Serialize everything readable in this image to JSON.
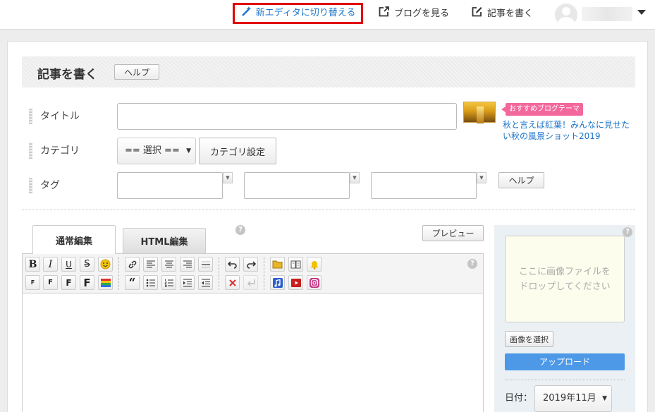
{
  "topbar": {
    "switch_editor": "新エディタに切り替える",
    "view_blog": "ブログを見る",
    "write_post": "記事を書く"
  },
  "header": {
    "title": "記事を書く",
    "help": "ヘルプ"
  },
  "form": {
    "title_label": "タイトル",
    "category_label": "カテゴリ",
    "category_value": "== 選択 ==",
    "category_settings": "カテゴリ設定",
    "tag_label": "タグ",
    "tag_help": "ヘルプ"
  },
  "theme": {
    "badge": "おすすめブログテーマ",
    "link": "秋と言えば紅葉！みんなに見せたい秋の風景ショット2019"
  },
  "editor": {
    "tab_normal": "通常編集",
    "tab_html": "HTML編集",
    "preview": "プレビュー",
    "help_mark": "?"
  },
  "sidebar": {
    "dropzone": "ここに画像ファイルをドロップしてください",
    "select_image": "画像を選択",
    "upload": "アップロード",
    "date_label": "日付：",
    "date_value": "2019年11月"
  },
  "colors": {
    "highlight_border": "#e00000",
    "link": "#1a73c9",
    "upload_button": "#4d99e8",
    "theme_badge": "#f3689c"
  }
}
